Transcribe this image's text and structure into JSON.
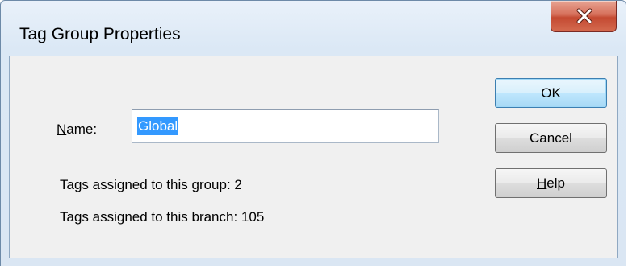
{
  "window": {
    "title": "Tag Group Properties"
  },
  "form": {
    "name_label_accel": "N",
    "name_label_rest": "ame:",
    "name_value": "Global",
    "tags_group_text": "Tags assigned to this group:  2",
    "tags_branch_text": "Tags assigned to this branch:  105"
  },
  "buttons": {
    "ok": "OK",
    "cancel": "Cancel",
    "help_accel": "H",
    "help_rest": "elp"
  },
  "icons": {
    "close": "close-icon"
  },
  "colors": {
    "selection": "#3399ff",
    "close_button": "#c44a32",
    "default_button_border": "#3c7fb1"
  }
}
